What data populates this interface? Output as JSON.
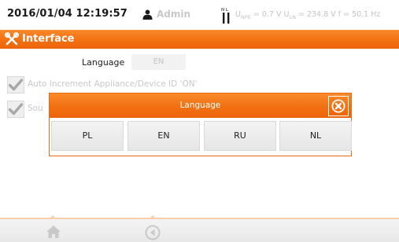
{
  "status_bar": {
    "datetime": "2016/01/04 12:19:57",
    "user_name": "Admin",
    "plug_letters": "N L",
    "u_npe_label": "U",
    "u_npe_sub": "NPE",
    "u_npe_value": " = 0.7 V ",
    "u_ln_label": "U",
    "u_ln_sub": "LN",
    "u_ln_value": " = 234.8 V ",
    "freq": "f = 50.1 Hz",
    "icons": [
      "user-icon",
      "plug-icon"
    ]
  },
  "header": {
    "title": "Interface",
    "icon": "tools-icon",
    "color": "#f27012"
  },
  "settings": {
    "language_label": "Language",
    "language_value": "EN",
    "checkbox1_label": "Auto Increment Appliance/Device ID 'ON'",
    "checkbox2_label": "Sou"
  },
  "modal": {
    "title": "Language",
    "close_icon": "close-circle-icon",
    "options": [
      "PL",
      "EN",
      "RU",
      "NL"
    ]
  },
  "bottom_bar": {
    "icons": [
      "home-icon",
      "back-icon"
    ]
  },
  "colors": {
    "accent": "#f27012",
    "disabled_text": "#c4c4c4"
  }
}
